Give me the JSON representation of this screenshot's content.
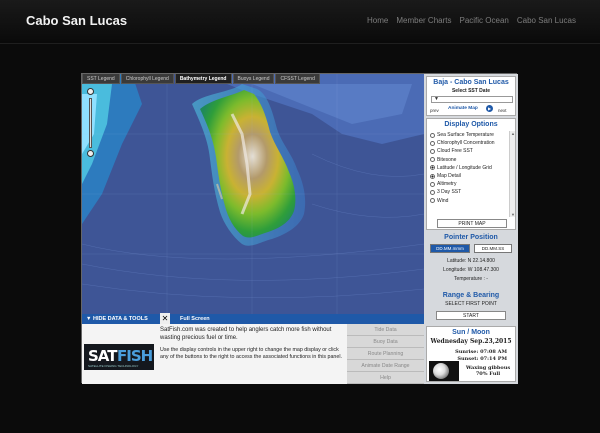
{
  "site": {
    "title": "Cabo San Lucas",
    "nav": [
      "Home",
      "Member Charts",
      "Pacific Ocean",
      "Cabo San Lucas"
    ]
  },
  "map": {
    "legend_tabs": [
      "SST Legend",
      "Chlorophyll Legend",
      "Bathymetry Legend",
      "Buoys Legend",
      "CFSST Legend"
    ],
    "active_legend": "Bathymetry Legend"
  },
  "tools": {
    "hide_label": "▼ HIDE DATA & TOOLS",
    "close_glyph": "✕",
    "fullscreen_label": "Full Screen",
    "info_1": "SatFish.com was created to help anglers catch more fish without wasting precious fuel or time.",
    "info_2": "Use the display controls in the upper right to change the map display or click any of the buttons to the right to access the associated functions in this panel.",
    "buttons": [
      "Tide Data",
      "Buoy Data",
      "Route Planning",
      "Animate Date Range",
      "Help"
    ]
  },
  "logo": {
    "sat": "SAT",
    "fish": "FISH",
    "tagline": "SATELLITE FISHING TECHNOLOGY"
  },
  "panel": {
    "region_title": "Baja - Cabo San Lucas",
    "sst_date_label": "Select SST Date",
    "prev": "prev",
    "animate": "Animate Map",
    "next": "next",
    "display_title": "Display Options",
    "options": [
      {
        "label": "Sea Surface Temperature",
        "selected": false
      },
      {
        "label": "Chlorophyll Concentration",
        "selected": false
      },
      {
        "label": "Cloud Free SST",
        "selected": false
      },
      {
        "label": "Bitesone",
        "selected": false
      },
      {
        "label": "Latitude / Longitude Grid",
        "selected": true
      },
      {
        "label": "Map Detail",
        "selected": true
      },
      {
        "label": "Altimetry",
        "selected": false
      },
      {
        "label": "3 Day SST",
        "selected": false
      },
      {
        "label": "Wind",
        "selected": false
      }
    ],
    "print_label": "PRINT MAP",
    "pointer_title": "Pointer Position",
    "format_a": "DD.MM.mmm",
    "format_b": "DD.MM.SS",
    "latitude": "Latitude:  N 22.14.800",
    "longitude": "Longitude: W 108.47.300",
    "temperature": "Temperature :  -",
    "range_title": "Range & Bearing",
    "range_label": "SELECT FIRST POINT",
    "start_label": "START",
    "sun_title": "Sun / Moon",
    "date": "Wednesday Sep.23,2015",
    "sunrise": "Sunrise: 07:08 AM",
    "sunset": "Sunset: 07:14 PM",
    "moon_phase": "Waxing gibbous",
    "moon_full": "70% Full"
  },
  "colors": {
    "accent": "#1f59a8",
    "ocean": "#3e5596",
    "land_low": "#2f9e3a",
    "land_high": "#d8d2c8"
  }
}
